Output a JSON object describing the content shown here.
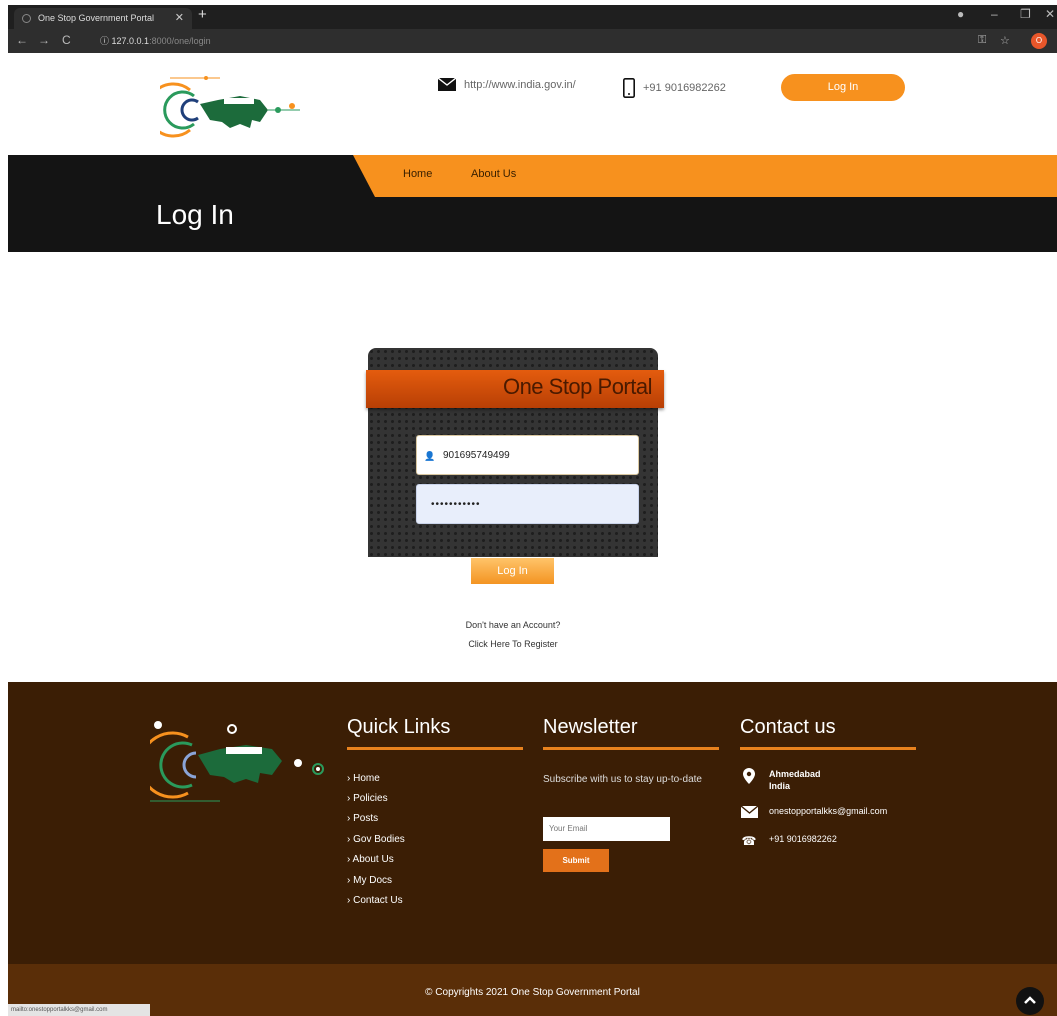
{
  "browser": {
    "tab_title": "One Stop Government Portal",
    "url_host": "127.0.0.1",
    "url_rest": ":8000/one/login"
  },
  "header": {
    "website": "http://www.india.gov.in/",
    "phone": "+91 9016982262",
    "login_label": "Log In"
  },
  "nav": {
    "items": [
      {
        "label": "Home"
      },
      {
        "label": "About Us"
      }
    ],
    "page_title": "Log In"
  },
  "login_card": {
    "title": "One Stop Portal",
    "username_value": "901695749499",
    "password_value": "•••••••••••",
    "submit_label": "Log In",
    "no_account_text": "Don't have an Account?",
    "register_link": "Click Here To Register"
  },
  "footer": {
    "quick_links": {
      "heading": "Quick Links",
      "items": [
        "› Home",
        "› Policies",
        "› Posts",
        "› Gov Bodies",
        "› About Us",
        "› My Docs",
        "› Contact Us"
      ]
    },
    "newsletter": {
      "heading": "Newsletter",
      "text": "Subscribe with us to stay up-to-date",
      "email_placeholder": "Your Email",
      "submit_label": "Submit"
    },
    "contact": {
      "heading": "Contact us",
      "city": "Ahmedabad",
      "country": "India",
      "email": "onestopportalkks@gmail.com",
      "phone": "+91 9016982262"
    },
    "copyright": "© Copyrights 2021 One Stop Government Portal"
  },
  "status_url": "mailto:onestopportalkks@gmail.com",
  "colors": {
    "accent_orange": "#f7911e",
    "dark_band": "#141414",
    "footer_brown": "#3b1e05",
    "footer_bottom": "#5a2e08"
  }
}
